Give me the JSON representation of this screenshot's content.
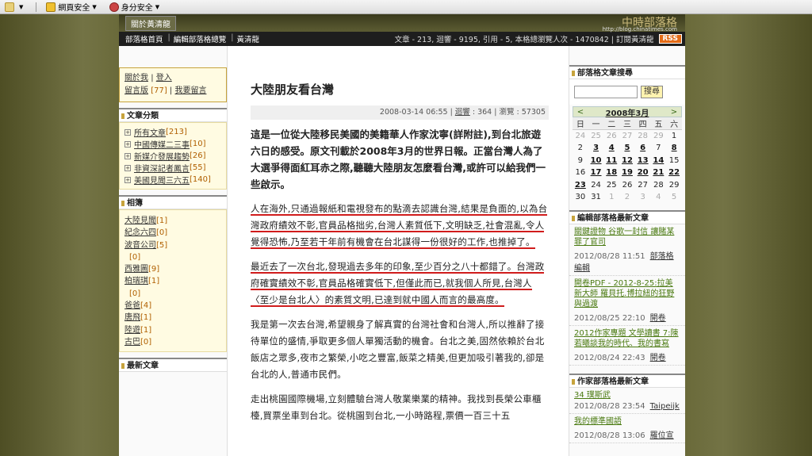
{
  "browser_toolbar": {
    "items": [
      {
        "label": "",
        "icon": "toolbar-checkmark-icon"
      },
      {
        "label": "網頁安全",
        "icon": "shield-icon"
      },
      {
        "label": "身分安全",
        "icon": "identity-icon"
      }
    ]
  },
  "banner": {
    "author_chip": "關於黃清龍",
    "logo_text": "中時部落格",
    "logo_sub": "http://blog.chinatimes.com"
  },
  "navbar": {
    "crumbs": [
      "部落格首頁",
      "編輯部落格總覽",
      "黃清龍"
    ],
    "stats": "文章 - 213, 迴響 - 9195, 引用 - 5, 本格總瀏覽人次 - 1470842 | 訂閱黃清龍",
    "rss": "RSS"
  },
  "left": {
    "about": {
      "about_label": "關於我",
      "login_label": "登入",
      "guestbook_label": "留言版",
      "guestbook_count": "[77]",
      "leave_msg_label": "我要留言"
    },
    "categories": {
      "title": "文章分類",
      "items": [
        {
          "label": "所有文章",
          "count": "[213]"
        },
        {
          "label": "中國傳媒二三事",
          "count": "[10]"
        },
        {
          "label": "新媒介發展趨勢",
          "count": "[26]"
        },
        {
          "label": "非資深記者鳳言",
          "count": "[55]"
        },
        {
          "label": "美國見聞三六五",
          "count": "[140]"
        }
      ]
    },
    "links": {
      "title": "相簿",
      "items": [
        {
          "label": "大陸見聞",
          "count": "[1]"
        },
        {
          "label": "紀念六四",
          "count": "[0]"
        },
        {
          "label": "波音公司",
          "count": "[5]"
        },
        {
          "label": "",
          "count": "[0]"
        },
        {
          "label": "西雅圖",
          "count": "[9]"
        },
        {
          "label": "柏瑞琪",
          "count": "[1]"
        },
        {
          "label": "",
          "count": "[0]"
        },
        {
          "label": "爸爸",
          "count": "[4]"
        },
        {
          "label": "唐飛",
          "count": "[1]"
        },
        {
          "label": "陸遊",
          "count": "[1]"
        },
        {
          "label": "古巴",
          "count": "[0]"
        }
      ]
    },
    "recent": {
      "title": "最新文章"
    }
  },
  "post": {
    "title": "大陸朋友看台灣",
    "meta_date": "2008-03-14 06:55",
    "meta_comment_label": "迴響",
    "meta_comment_count": "364",
    "meta_views_label": "瀏覽",
    "meta_views_count": "57305",
    "lead": "這是一位從大陸移民美國的美籍華人作家沈寧(詳附註),到台北旅遊六日的感受。原文刊載於2008年3月的世界日報。正當台灣人為了大選爭得面紅耳赤之際,聽聽大陸朋友怎麼看台灣,或許可以給我們一些啟示。",
    "para1": "人在海外,只通過報紙和電視發布的點滴去認識台灣,結果是負面的,以為台灣政府績效不彰,官員品格拙劣,台灣人素質低下,文明缺乏,社會混亂,令人覺得恐怖,乃至若干年前有機會在台北謀得一份很好的工作,也推掉了。",
    "para2": "最近去了一次台北,發現過去多年的印象,至少百分之八十都錯了。台灣政府確實績效不彰,官員品格確實低下,但僅此而已,就我個人所見,台灣人〈至少是台北人〉的素質文明,已達到就中國人而言的最高度。",
    "para3": "我是第一次去台灣,希望親身了解真實的台灣社會和台灣人,所以推辭了接待單位的盛情,爭取更多個人單獨活動的機會。台北之美,固然依賴於台北飯店之眾多,夜市之繁榮,小吃之豐富,飯菜之精美,但更加吸引著我的,卻是台北的人,普通市民們。",
    "para4": "走出桃園國際機場,立刻體驗台灣人敬業樂業的精神。我找到長榮公車櫃檯,買票坐車到台北。從桃園到台北,一小時路程,票價一百三十五"
  },
  "right": {
    "search": {
      "title": "部落格文章搜尋",
      "button": "搜尋"
    },
    "calendar": {
      "prev": "<",
      "next": ">",
      "month": "2008年3月",
      "weekdays": [
        "日",
        "一",
        "二",
        "三",
        "四",
        "五",
        "六"
      ],
      "rows": [
        [
          "24",
          "25",
          "26",
          "27",
          "28",
          "29",
          "1"
        ],
        [
          "2",
          "3",
          "4",
          "5",
          "6",
          "7",
          "8"
        ],
        [
          "9",
          "10",
          "11",
          "12",
          "13",
          "14",
          "15"
        ],
        [
          "16",
          "17",
          "18",
          "19",
          "20",
          "21",
          "22"
        ],
        [
          "23",
          "24",
          "25",
          "26",
          "27",
          "28",
          "29"
        ],
        [
          "30",
          "31",
          "1",
          "2",
          "3",
          "4",
          "5"
        ]
      ]
    },
    "editor_latest": {
      "title": "編輯部落格最新文章",
      "items": [
        {
          "title": "關鍵證物 谷歌一封信 讓賭某罪了官司",
          "date": "2012/08/28 11:51",
          "who": "部落格編輯"
        },
        {
          "title": "開卷PDF - 2012-8-25:拉美新大師 羅貝托.博拉紐的狂野與過渡",
          "date": "2012/08/25 22:10",
          "who": "開卷"
        },
        {
          "title": "2012作家專題 文學讀書 7:陳若曦談我的時代、我的書寫",
          "date": "2012/08/24 22:43",
          "who": "開卷"
        }
      ]
    },
    "writer_latest": {
      "title": "作家部落格最新文章",
      "items": [
        {
          "title": "34 璞斯武",
          "date": "2012/08/28 23:54",
          "who": "Taipeijk"
        },
        {
          "title": "我的標準國語",
          "date": "2012/08/28 13:06",
          "who": "羅位宣"
        }
      ]
    }
  }
}
